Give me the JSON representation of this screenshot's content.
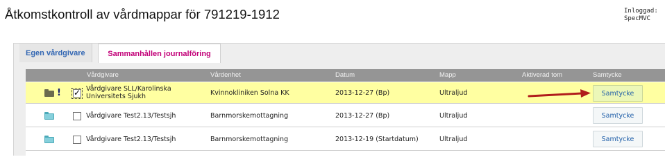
{
  "header": {
    "title": "Åtkomstkontroll av vårdmappar för 791219-1912",
    "login_label": "Inloggad:",
    "login_user": "SpecMVC"
  },
  "tabs": [
    {
      "label": "Egen vårdgivare",
      "active": false
    },
    {
      "label": "Sammanhållen journalföring",
      "active": true
    }
  ],
  "table": {
    "columns": [
      "Vårdgivare",
      "Vårdenhet",
      "Datum",
      "Mapp",
      "Aktiverad tom",
      "Samtycke"
    ],
    "rows": [
      {
        "folder_icon": "folder-dark-icon",
        "flag": "!",
        "checked": true,
        "vardgivare": "Vårdgivare SLL/Karolinska Universitets Sjukh",
        "vardenhet": "Kvinnokliniken Solna KK",
        "datum": "2013-12-27 (Bp)",
        "mapp": "Ultraljud",
        "aktiverad_tom": "",
        "button": "Samtycke",
        "highlighted": true
      },
      {
        "folder_icon": "folder-teal-icon",
        "flag": "",
        "checked": false,
        "vardgivare": "Vårdgivare Test2.13/Testsjh",
        "vardenhet": "Barnmorskemottagning",
        "datum": "2013-12-27 (Bp)",
        "mapp": "Ultraljud",
        "aktiverad_tom": "",
        "button": "Samtycke",
        "highlighted": false
      },
      {
        "folder_icon": "folder-teal-icon",
        "flag": "",
        "checked": false,
        "vardgivare": "Vårdgivare Test2.13/Testsjh",
        "vardenhet": "Barnmorskemottagning",
        "datum": "2013-12-19 (Startdatum)",
        "mapp": "Ultraljud",
        "aktiverad_tom": "",
        "button": "Samtycke",
        "highlighted": false
      }
    ]
  },
  "colors": {
    "tab_own": "#3367b3",
    "tab_shared": "#c20078",
    "highlight_row": "#ffffa1",
    "header_bg": "#959595",
    "arrow": "#b01c1c"
  }
}
